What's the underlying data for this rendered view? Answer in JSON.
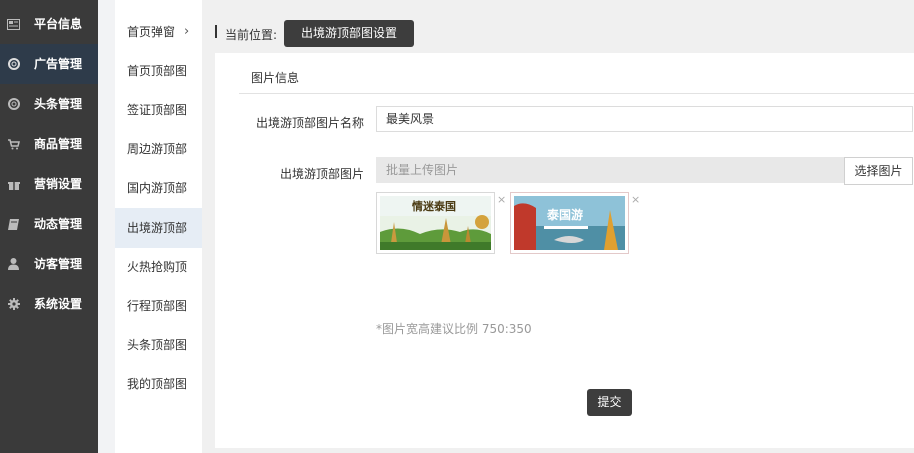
{
  "sidebar": {
    "items": [
      {
        "label": "平台信息",
        "icon": "newspaper-icon"
      },
      {
        "label": "广告管理",
        "icon": "lifebuoy-icon"
      },
      {
        "label": "头条管理",
        "icon": "lifebuoy-icon"
      },
      {
        "label": "商品管理",
        "icon": "cart-icon"
      },
      {
        "label": "营销设置",
        "icon": "gift-icon"
      },
      {
        "label": "动态管理",
        "icon": "book-icon"
      },
      {
        "label": "访客管理",
        "icon": "user-icon"
      },
      {
        "label": "系统设置",
        "icon": "gear-icon"
      }
    ],
    "active_index": 1
  },
  "submenu": {
    "items": [
      {
        "label": "首页弹窗",
        "chevron": "›"
      },
      {
        "label": "首页顶部图"
      },
      {
        "label": "签证顶部图"
      },
      {
        "label": "周边游顶部"
      },
      {
        "label": "国内游顶部"
      },
      {
        "label": "出境游顶部"
      },
      {
        "label": "火热抢购顶"
      },
      {
        "label": "行程顶部图"
      },
      {
        "label": "头条顶部图"
      },
      {
        "label": "我的顶部图"
      }
    ],
    "active_index": 5
  },
  "breadcrumb": {
    "label": "当前位置:",
    "current": "出境游顶部图设置"
  },
  "form": {
    "section_title": "图片信息",
    "name_label": "出境游顶部图片名称",
    "name_value": "最美风景",
    "image_label": "出境游顶部图片",
    "upload_placeholder": "批量上传图片",
    "choose_button": "选择图片",
    "thumbnails": [
      {
        "caption": "情迷泰国",
        "close": "×"
      },
      {
        "caption": "泰国游",
        "close": "×"
      }
    ],
    "hint": "*图片宽高建议比例 750:350",
    "submit": "提交"
  },
  "colors": {
    "sidebar_bg": "#3a3a3a",
    "sidebar_active": "#2e3b4a",
    "button_dark": "#3d3d3d",
    "submenu_active": "#e6edf5"
  }
}
